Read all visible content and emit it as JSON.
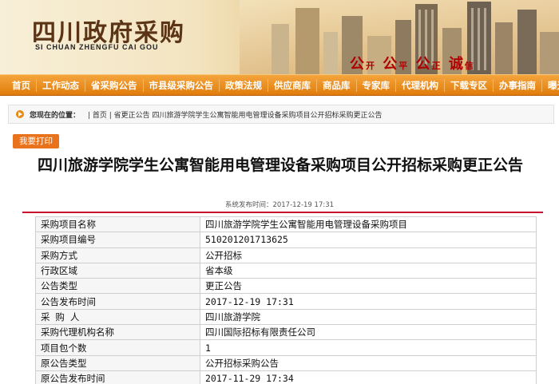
{
  "site": {
    "logo_cn": "四川政府采购",
    "logo_en": "SI CHUAN ZHENGFU CAI GOU",
    "slogan": [
      "公",
      "开",
      "公",
      "平",
      "公",
      "正",
      "诚",
      "信"
    ]
  },
  "nav": {
    "items": [
      "首页",
      "工作动态",
      "省采购公告",
      "市县级采购公告",
      "政策法规",
      "供应商库",
      "商品库",
      "专家库",
      "代理机构",
      "下载专区",
      "办事指南",
      "曝光台"
    ]
  },
  "breadcrumb": {
    "label": "您现在的位置：",
    "path": "| 首页 | 省更正公告 四川旅游学院学生公寓智能用电管理设备采购项目公开招标采购更正公告"
  },
  "print_button": "我要打印",
  "article": {
    "title": "四川旅游学院学生公寓智能用电管理设备采购项目公开招标采购更正公告",
    "published": "系统发布时间：2017-12-19 17:31"
  },
  "table": {
    "rows": [
      {
        "key": "采购项目名称",
        "value": "四川旅游学院学生公寓智能用电管理设备采购项目"
      },
      {
        "key": "采购项目编号",
        "value": "510201201713625"
      },
      {
        "key": "采购方式",
        "value": "公开招标"
      },
      {
        "key": "行政区域",
        "value": "省本级"
      },
      {
        "key": "公告类型",
        "value": "更正公告"
      },
      {
        "key": "公告发布时间",
        "value": "2017-12-19 17:31"
      },
      {
        "key": "采 购 人",
        "value": "四川旅游学院"
      },
      {
        "key": "采购代理机构名称",
        "value": "四川国际招标有限责任公司"
      },
      {
        "key": "项目包个数",
        "value": "1"
      },
      {
        "key": "原公告类型",
        "value": "公开招标采购公告"
      },
      {
        "key": "原公告发布时间",
        "value": "2017-11-29 17:34"
      }
    ]
  },
  "colors": {
    "nav_orange": "#e88a18",
    "print_button": "#e8731c",
    "title_rule": "#c8102e",
    "logo_brown": "#5a3415"
  }
}
